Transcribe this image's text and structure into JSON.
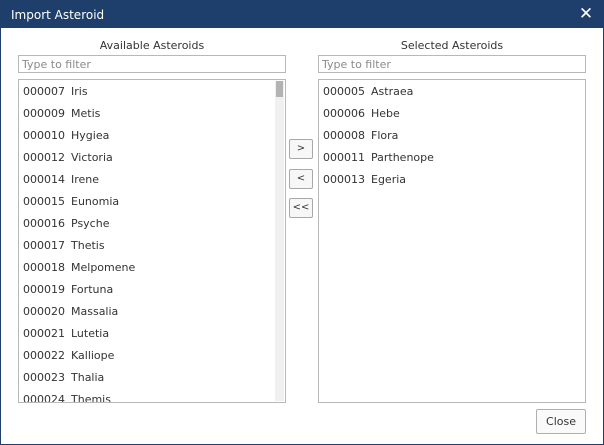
{
  "window": {
    "title": "Import Asteroid",
    "close_glyph": "✕"
  },
  "available": {
    "label": "Available Asteroids",
    "filter_placeholder": "Type to filter",
    "items": [
      {
        "num": "000007",
        "name": "Iris"
      },
      {
        "num": "000009",
        "name": "Metis"
      },
      {
        "num": "000010",
        "name": "Hygiea"
      },
      {
        "num": "000012",
        "name": "Victoria"
      },
      {
        "num": "000014",
        "name": "Irene"
      },
      {
        "num": "000015",
        "name": "Eunomia"
      },
      {
        "num": "000016",
        "name": "Psyche"
      },
      {
        "num": "000017",
        "name": "Thetis"
      },
      {
        "num": "000018",
        "name": "Melpomene"
      },
      {
        "num": "000019",
        "name": "Fortuna"
      },
      {
        "num": "000020",
        "name": "Massalia"
      },
      {
        "num": "000021",
        "name": "Lutetia"
      },
      {
        "num": "000022",
        "name": "Kalliope"
      },
      {
        "num": "000023",
        "name": "Thalia"
      },
      {
        "num": "000024",
        "name": "Themis"
      }
    ]
  },
  "selected": {
    "label": "Selected Asteroids",
    "filter_placeholder": "Type to filter",
    "items": [
      {
        "num": "000005",
        "name": "Astraea"
      },
      {
        "num": "000006",
        "name": "Hebe"
      },
      {
        "num": "000008",
        "name": "Flora"
      },
      {
        "num": "000011",
        "name": "Parthenope"
      },
      {
        "num": "000013",
        "name": "Egeria"
      }
    ]
  },
  "buttons": {
    "add": ">",
    "remove": "<",
    "remove_all": "<<",
    "close": "Close"
  }
}
